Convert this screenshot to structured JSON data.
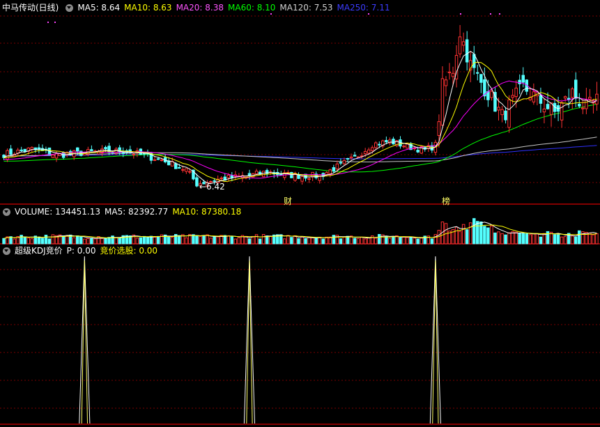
{
  "title": "中马传动(日线)",
  "colors": {
    "up": "#ff3232",
    "down": "#54ffff",
    "grid": "#7a0000",
    "ma5": "#ffffff",
    "ma10": "#ffff00",
    "ma20": "#ff00ff",
    "ma60": "#00ff00",
    "ma120": "#c8c8c8",
    "ma250": "#3030ff",
    "signal": "#ffff66"
  },
  "price_panel": {
    "legend": [
      {
        "key": "ma5",
        "text": "MA5: 8.64",
        "color": "#ffffff"
      },
      {
        "key": "ma10",
        "text": "MA10: 8.63",
        "color": "#ffff00"
      },
      {
        "key": "ma20",
        "text": "MA20: 8.38",
        "color": "#ff55ff"
      },
      {
        "key": "ma60",
        "text": "MA60: 8.10",
        "color": "#00ff00"
      },
      {
        "key": "ma120",
        "text": "MA120: 7.53",
        "color": "#d0d0d0"
      },
      {
        "key": "ma250",
        "text": "MA250: 7.11",
        "color": "#3c3cff"
      }
    ],
    "low_marker": "←6.42",
    "events": [
      {
        "text": "财",
        "index": 81
      },
      {
        "text": "榜",
        "index": 126
      }
    ]
  },
  "volume_panel": {
    "legend": [
      {
        "key": "vol",
        "text": "VOLUME: 134451.13",
        "color": "#ffffff"
      },
      {
        "key": "vma5",
        "text": "MA5: 82392.77",
        "color": "#ffffff"
      },
      {
        "key": "vma10",
        "text": "MA10: 87380.18",
        "color": "#ffff00"
      }
    ]
  },
  "kdj_panel": {
    "legend": [
      {
        "key": "name",
        "text": "超级KDJ竞价",
        "color": "#ffffff"
      },
      {
        "key": "p",
        "text": "P: 0.00",
        "color": "#ffffff"
      },
      {
        "key": "select",
        "text": "竞价选股: 0.00",
        "color": "#ffff00"
      }
    ]
  },
  "chart_data": {
    "type": "candlestick",
    "count": 170,
    "price_range": [
      5.6,
      15.2
    ],
    "anchors": [
      [
        0,
        8.1
      ],
      [
        8,
        8.35
      ],
      [
        15,
        8.05
      ],
      [
        25,
        8.2
      ],
      [
        35,
        8.25
      ],
      [
        45,
        7.8
      ],
      [
        52,
        7.3
      ],
      [
        55,
        6.6
      ],
      [
        58,
        6.7
      ],
      [
        62,
        6.85
      ],
      [
        70,
        7.0
      ],
      [
        75,
        7.2
      ],
      [
        80,
        7.05
      ],
      [
        85,
        7.0
      ],
      [
        90,
        7.0
      ],
      [
        95,
        7.45
      ],
      [
        100,
        7.9
      ],
      [
        105,
        8.6
      ],
      [
        110,
        8.75
      ],
      [
        115,
        8.5
      ],
      [
        120,
        8.3
      ],
      [
        123,
        8.55
      ],
      [
        125,
        11.5
      ],
      [
        128,
        12.4
      ],
      [
        130,
        14.3
      ],
      [
        133,
        12.6
      ],
      [
        135,
        12.0
      ],
      [
        138,
        11.2
      ],
      [
        142,
        10.0
      ],
      [
        148,
        11.5
      ],
      [
        152,
        10.9
      ],
      [
        157,
        10.2
      ],
      [
        162,
        11.2
      ],
      [
        166,
        10.4
      ],
      [
        169,
        10.8
      ]
    ],
    "low_value": 6.42,
    "signal_peaks": [
      23,
      70,
      123
    ]
  }
}
